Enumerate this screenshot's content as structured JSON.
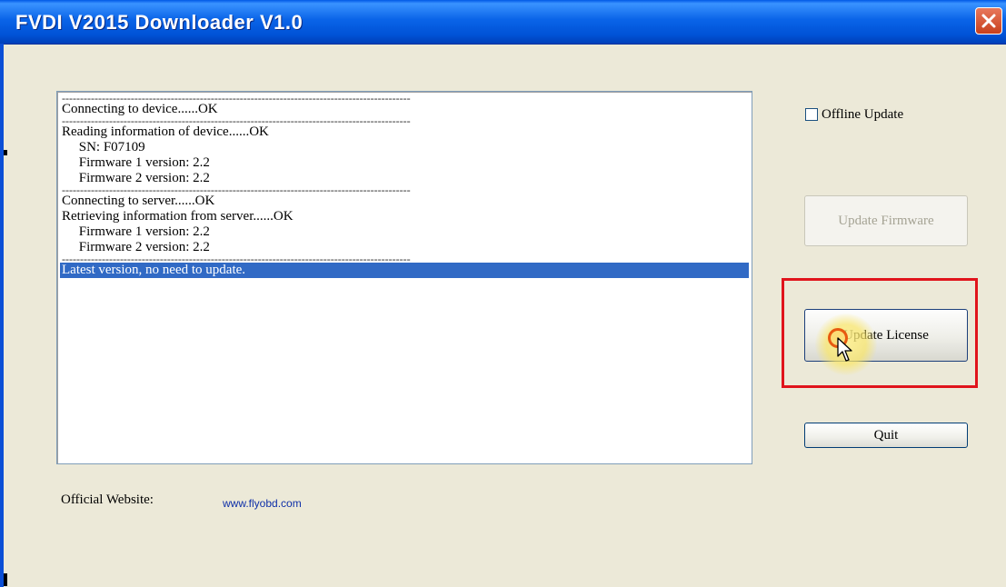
{
  "window": {
    "title": "FVDI  V2015 Downloader V1.0",
    "close_icon": "close-icon"
  },
  "log": {
    "lines": [
      {
        "type": "sep",
        "text": "------------------------------------------------------------------------------------------------"
      },
      {
        "type": "text",
        "text": "Connecting to device......OK"
      },
      {
        "type": "sep",
        "text": "------------------------------------------------------------------------------------------------"
      },
      {
        "type": "text",
        "text": "Reading information of device......OK"
      },
      {
        "type": "text",
        "text": "     SN: F07109"
      },
      {
        "type": "text",
        "text": "     Firmware 1 version: 2.2"
      },
      {
        "type": "text",
        "text": "     Firmware 2 version: 2.2"
      },
      {
        "type": "sep",
        "text": "------------------------------------------------------------------------------------------------"
      },
      {
        "type": "text",
        "text": "Connecting to server......OK"
      },
      {
        "type": "text",
        "text": "Retrieving information from server......OK"
      },
      {
        "type": "text",
        "text": "     Firmware 1 version: 2.2"
      },
      {
        "type": "text",
        "text": "     Firmware 2 version: 2.2"
      },
      {
        "type": "sep",
        "text": "------------------------------------------------------------------------------------------------"
      },
      {
        "type": "selected",
        "text": "Latest version, no need to update."
      }
    ]
  },
  "options": {
    "offline_update_label": "Offline Update",
    "offline_update_checked": false
  },
  "buttons": {
    "update_firmware": "Update Firmware",
    "update_license": "Update License",
    "quit": "Quit"
  },
  "footer": {
    "website_label": "Official Website:",
    "website_link": "www.flyobd.com"
  },
  "colors": {
    "titlebar": "#0a64e8",
    "selection": "#316ac5",
    "highlight_box": "#e0141c",
    "background": "#ece9d8"
  }
}
